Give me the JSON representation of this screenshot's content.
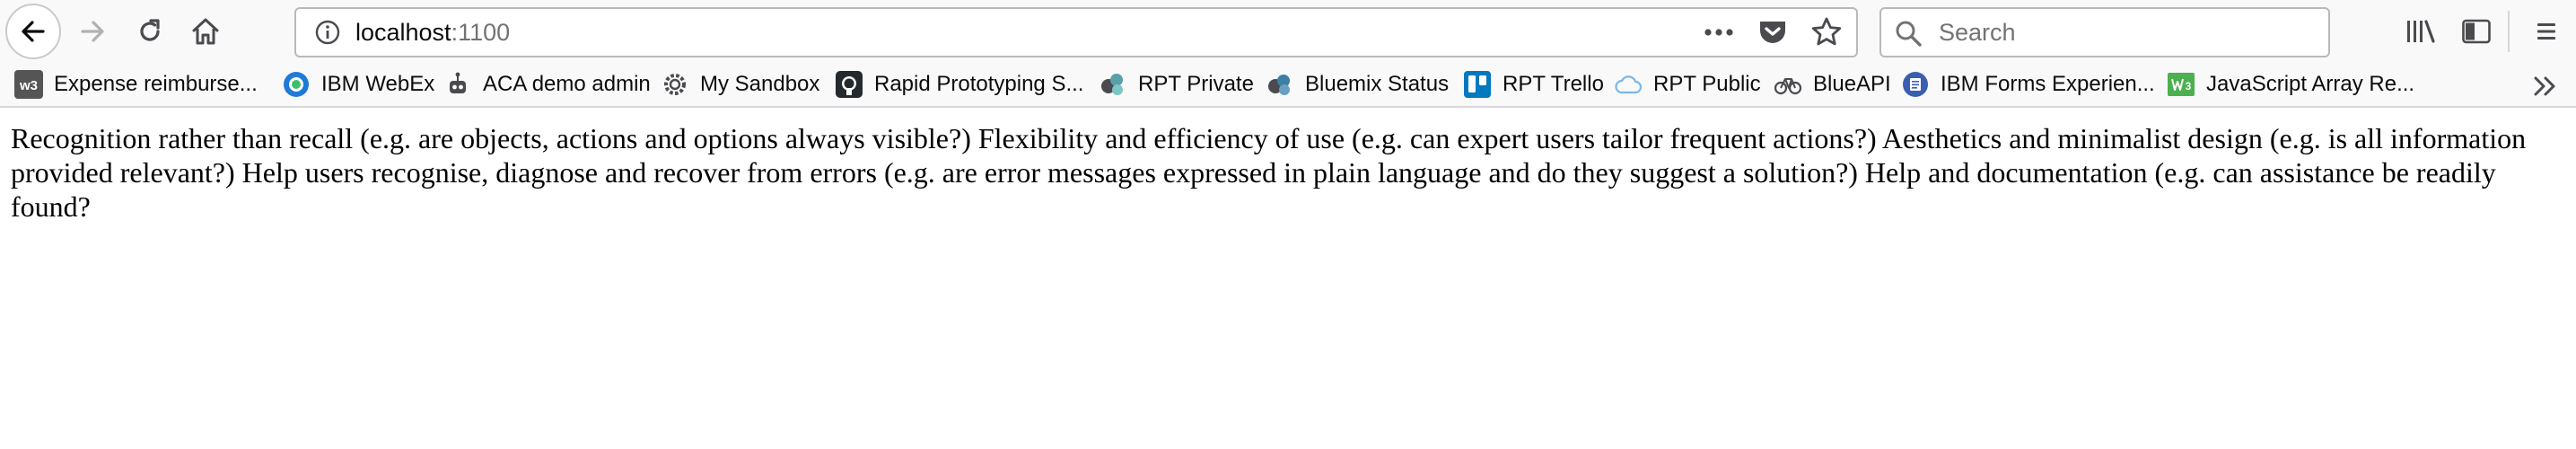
{
  "toolbar": {
    "url_host": "localhost",
    "url_port": ":1100",
    "search_placeholder": "Search",
    "icons": {
      "back": "back-arrow-icon",
      "forward": "forward-arrow-icon",
      "reload": "reload-icon",
      "home": "home-icon",
      "site_info": "info-icon",
      "page_actions": "more-icon",
      "pocket": "pocket-icon",
      "bookmark": "star-icon",
      "search": "search-icon",
      "library": "library-icon",
      "sidebar": "sidebar-icon",
      "menu": "hamburger-menu-icon"
    }
  },
  "bookmarks": {
    "items": [
      {
        "label": "Expense reimburse...",
        "icon": "w3-icon"
      },
      {
        "label": "IBM WebEx",
        "icon": "webex-icon"
      },
      {
        "label": "ACA demo admin",
        "icon": "robot-icon"
      },
      {
        "label": "My Sandbox",
        "icon": "gear-icon"
      },
      {
        "label": "Rapid Prototyping S...",
        "icon": "github-icon"
      },
      {
        "label": "RPT Private",
        "icon": "rpt-icon"
      },
      {
        "label": "Bluemix Status",
        "icon": "bluemix-icon"
      },
      {
        "label": "RPT Trello",
        "icon": "trello-icon"
      },
      {
        "label": "RPT Public",
        "icon": "cloud-icon"
      },
      {
        "label": "BlueAPI",
        "icon": "bicycle-icon"
      },
      {
        "label": "IBM Forms Experien...",
        "icon": "forms-icon"
      },
      {
        "label": "JavaScript Array Re...",
        "icon": "w3schools-icon"
      }
    ],
    "overflow_icon": "chevron-double-right-icon"
  },
  "page": {
    "text": "Recognition rather than recall (e.g. are objects, actions and options always visible?) Flexibility and efficiency of use (e.g. can expert users tailor frequent actions?) Aesthetics and minimalist design (e.g. is all information provided relevant?) Help users recognise, diagnose and recover from errors (e.g. are error messages expressed in plain language and do they suggest a solution?) Help and documentation (e.g. can assistance be readily found?"
  },
  "colors": {
    "chrome_bg": "#f9f9fa",
    "icon_gray": "#4a4a4f",
    "webex_blue": "#1f7ad8",
    "trello_blue": "#0079bf",
    "w3_gray": "#555555",
    "w3schools_green": "#4caf50",
    "forms_blue": "#3a5fb0"
  }
}
